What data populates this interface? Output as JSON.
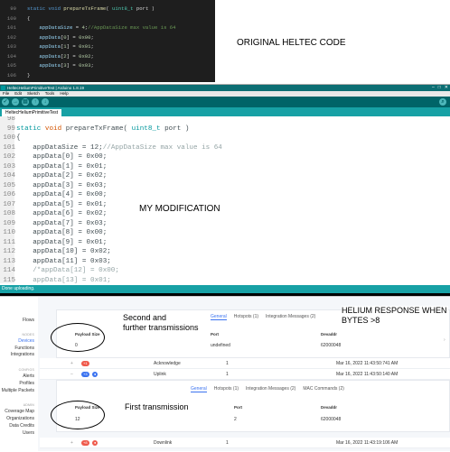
{
  "original": {
    "caption": "ORIGINAL HELTEC CODE",
    "lines": [
      {
        "n": "99",
        "segs": [
          [
            "kw",
            "static "
          ],
          [
            "kw",
            "void "
          ],
          [
            "fn",
            "prepareTxFrame"
          ],
          [
            "p",
            "( "
          ],
          [
            "ty",
            "uint8_t"
          ],
          [
            "p",
            " port )"
          ]
        ]
      },
      {
        "n": "100",
        "segs": [
          [
            "p",
            "{"
          ]
        ]
      },
      {
        "n": "101",
        "segs": [
          [
            "var",
            "    appDataSize"
          ],
          [
            "p",
            " = "
          ],
          [
            "num",
            "4"
          ],
          [
            "p",
            ";"
          ],
          [
            "cm",
            "//AppDataSize max value is 64"
          ]
        ]
      },
      {
        "n": "102",
        "segs": [
          [
            "var",
            "    appData"
          ],
          [
            "p",
            "["
          ],
          [
            "num",
            "0"
          ],
          [
            "p",
            "] = "
          ],
          [
            "num",
            "0x00"
          ],
          [
            "p",
            ";"
          ]
        ]
      },
      {
        "n": "103",
        "segs": [
          [
            "var",
            "    appData"
          ],
          [
            "p",
            "["
          ],
          [
            "num",
            "1"
          ],
          [
            "p",
            "] = "
          ],
          [
            "num",
            "0x01"
          ],
          [
            "p",
            ";"
          ]
        ]
      },
      {
        "n": "104",
        "segs": [
          [
            "var",
            "    appData"
          ],
          [
            "p",
            "["
          ],
          [
            "num",
            "2"
          ],
          [
            "p",
            "] = "
          ],
          [
            "num",
            "0x02"
          ],
          [
            "p",
            ";"
          ]
        ]
      },
      {
        "n": "105",
        "segs": [
          [
            "var",
            "    appData"
          ],
          [
            "p",
            "["
          ],
          [
            "num",
            "3"
          ],
          [
            "p",
            "] = "
          ],
          [
            "num",
            "0x03"
          ],
          [
            "p",
            ";"
          ]
        ]
      },
      {
        "n": "106",
        "segs": [
          [
            "p",
            "}"
          ]
        ]
      }
    ]
  },
  "ide": {
    "title": "HeltecHeliumPrimitiveTest | Arduino 1.8.19",
    "window_buttons": [
      "–",
      "□",
      "✕"
    ],
    "menu": [
      "File",
      "Edit",
      "Sketch",
      "Tools",
      "Help"
    ],
    "toolbar": [
      {
        "icon": "verify-icon",
        "glyph": "✓"
      },
      {
        "icon": "upload-icon",
        "glyph": "→"
      },
      {
        "icon": "new-icon",
        "glyph": "▤"
      },
      {
        "icon": "open-icon",
        "glyph": "↑"
      },
      {
        "icon": "save-icon",
        "glyph": "↓"
      }
    ],
    "tab": "HeltecHeliumPrimitiveTest",
    "caption": "MY MODIFICATION",
    "status": "Done uploading.",
    "lines": [
      {
        "n": "98",
        "segs": [
          [
            "p",
            ""
          ]
        ]
      },
      {
        "n": "99",
        "segs": [
          [
            "kwa",
            "static "
          ],
          [
            "kwb",
            "void "
          ],
          [
            "p",
            "prepareTxFrame( "
          ],
          [
            "ty2",
            "uint8_t"
          ],
          [
            "p",
            " port )"
          ]
        ]
      },
      {
        "n": "100",
        "segs": [
          [
            "p",
            "{"
          ]
        ]
      },
      {
        "n": "101",
        "segs": [
          [
            "p",
            "    appDataSize = 12;"
          ],
          [
            "cm2",
            "//AppDataSize max value is 64"
          ]
        ]
      },
      {
        "n": "102",
        "segs": [
          [
            "p",
            "    appData[0] = 0x00;"
          ]
        ]
      },
      {
        "n": "103",
        "segs": [
          [
            "p",
            "    appData[1] = 0x01;"
          ]
        ]
      },
      {
        "n": "104",
        "segs": [
          [
            "p",
            "    appData[2] = 0x02;"
          ]
        ]
      },
      {
        "n": "105",
        "segs": [
          [
            "p",
            "    appData[3] = 0x03;"
          ]
        ]
      },
      {
        "n": "106",
        "segs": [
          [
            "p",
            "    appData[4] = 0x00;"
          ]
        ]
      },
      {
        "n": "107",
        "segs": [
          [
            "p",
            "    appData[5] = 0x01;"
          ]
        ]
      },
      {
        "n": "108",
        "segs": [
          [
            "p",
            "    appData[6] = 0x02;"
          ]
        ]
      },
      {
        "n": "109",
        "segs": [
          [
            "p",
            "    appData[7] = 0x03;"
          ]
        ]
      },
      {
        "n": "110",
        "segs": [
          [
            "p",
            "    appData[8] = 0x00;"
          ]
        ]
      },
      {
        "n": "111",
        "segs": [
          [
            "p",
            "    appData[9] = 0x01;"
          ]
        ]
      },
      {
        "n": "112",
        "segs": [
          [
            "p",
            "    appData[10] = 0x02;"
          ]
        ]
      },
      {
        "n": "113",
        "segs": [
          [
            "p",
            "    appData[11] = 0x03;"
          ]
        ]
      },
      {
        "n": "114",
        "segs": [
          [
            "cm2",
            "    /*appData[12] = 0x00;"
          ]
        ]
      },
      {
        "n": "115",
        "segs": [
          [
            "cm2",
            "    appData[13] = 0x01;"
          ]
        ]
      }
    ]
  },
  "helium": {
    "sidebar": {
      "flows": "Flows",
      "nodes_header": "NODES",
      "devices": "Devices",
      "functions": "Functions",
      "integrations": "Integrations",
      "config_header": "CONFIGS",
      "alerts": "Alerts",
      "profiles": "Profiles",
      "multiple_packets": "Multiple Packets",
      "admin_header": "ADMIN",
      "coverage": "Coverage Map",
      "organizations": "Organizations",
      "data_credits": "Data Credits",
      "users": "Users"
    },
    "annotations": {
      "response": "HELIUM RESPONSE WHEN BYTES >8",
      "second_line1": "Second and",
      "second_line2": "further transmissions",
      "first": "First transmission"
    },
    "detail_top": {
      "tabs": [
        "General",
        "Hotspots (1)",
        "Integration Messages (2)"
      ],
      "headers": [
        "Payload Size",
        "Port",
        "Devaddr"
      ],
      "values": [
        "0",
        "undefined",
        "62000048"
      ]
    },
    "rows": [
      {
        "pill": "+1",
        "pill_color": "#ef5a4c",
        "type": "Acknowledge",
        "count": "1",
        "time": "Mar 16, 2022 11:43:50:741 AM"
      },
      {
        "pill": "+3",
        "pill_color": "#3b73f0",
        "type": "Uplink",
        "count": "1",
        "time": "Mar 16, 2022 11:43:50:140 AM"
      },
      {
        "pill": "+8",
        "pill_color": "#ef5a4c",
        "type": "Downlink",
        "count": "1",
        "time": "Mar 16, 2022 11:43:19:106 AM"
      }
    ],
    "detail_bottom": {
      "tabs": [
        "General",
        "Hotspots (1)",
        "Integration Messages (2)",
        "MAC Commands (2)"
      ],
      "headers": [
        "Payload Size",
        "Port",
        "Devaddr"
      ],
      "values": [
        "12",
        "2",
        "62000048"
      ]
    }
  }
}
